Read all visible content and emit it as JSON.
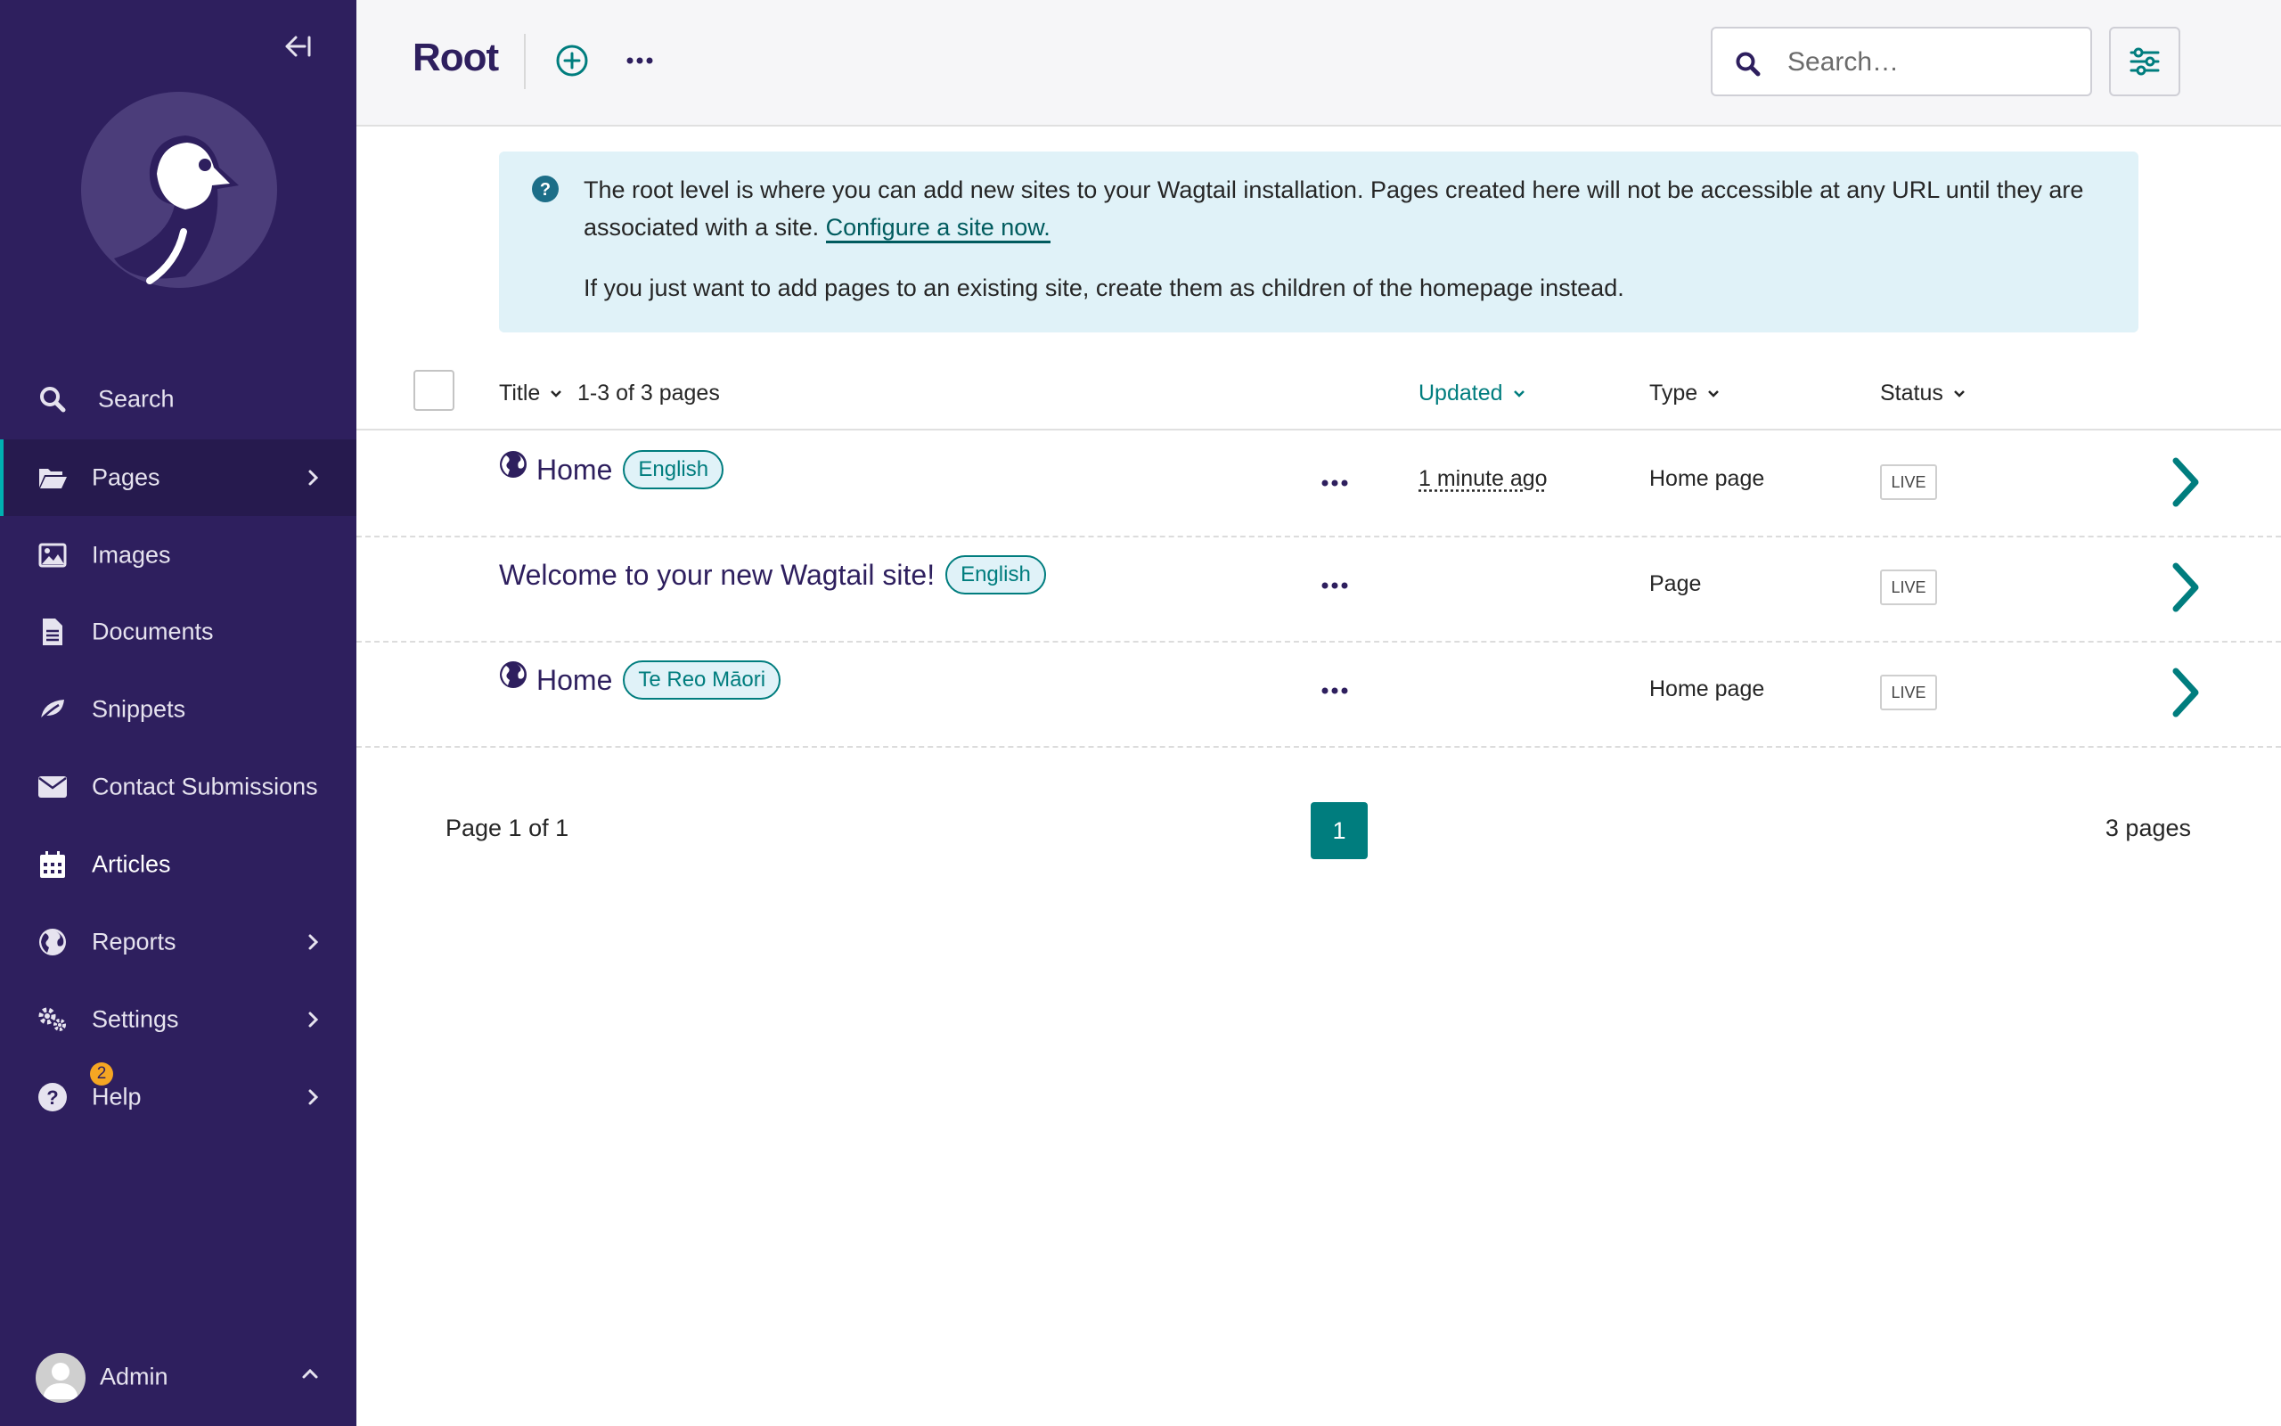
{
  "sidebar": {
    "items": [
      {
        "label": "Search",
        "icon": "search-icon"
      },
      {
        "label": "Pages",
        "icon": "folder-open-icon"
      },
      {
        "label": "Images",
        "icon": "image-icon"
      },
      {
        "label": "Documents",
        "icon": "document-icon"
      },
      {
        "label": "Snippets",
        "icon": "snippet-icon"
      },
      {
        "label": "Contact Submissions",
        "icon": "envelope-icon"
      },
      {
        "label": "Articles",
        "icon": "calendar-icon"
      },
      {
        "label": "Reports",
        "icon": "globe-icon"
      },
      {
        "label": "Settings",
        "icon": "cogs-icon"
      },
      {
        "label": "Help",
        "icon": "help-icon",
        "badge": "2"
      }
    ],
    "account": {
      "name": "Admin"
    }
  },
  "header": {
    "title": "Root",
    "search_placeholder": "Search…"
  },
  "info": {
    "text1": "The root level is where you can add new sites to your Wagtail installation. Pages created here will not be accessible at any URL until they are associated with a site. ",
    "link": "Configure a site now.",
    "text2": "If you just want to add pages to an existing site, create them as children of the homepage instead."
  },
  "listing": {
    "headers": {
      "title": "Title",
      "count": "1-3 of 3 pages",
      "updated": "Updated",
      "type": "Type",
      "status": "Status"
    },
    "rows": [
      {
        "title": "Home",
        "locale": "English",
        "updated": "1 minute ago",
        "type": "Home page",
        "status": "LIVE",
        "globe": true
      },
      {
        "title": "Welcome to your new Wagtail site!",
        "locale": "English",
        "updated": "",
        "type": "Page",
        "status": "LIVE",
        "globe": false
      },
      {
        "title": "Home",
        "locale": "Te Reo Māori",
        "updated": "",
        "type": "Home page",
        "status": "LIVE",
        "globe": true
      }
    ]
  },
  "pagination": {
    "page_of": "Page 1 of 1",
    "current": "1",
    "total": "3 pages"
  },
  "colors": {
    "sidebar": "#2e1f5e",
    "accent": "#007d7e",
    "info_bg": "#e0f2f8",
    "badge": "#f5a623"
  }
}
